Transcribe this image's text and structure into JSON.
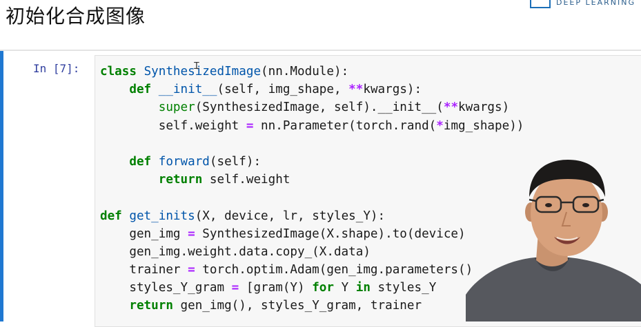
{
  "header": {
    "title": "初始化合成图像",
    "logo_text": "DEEP LEARNING"
  },
  "cell": {
    "prompt": "In [7]:",
    "lines": [
      [
        {
          "t": "class",
          "c": "kw"
        },
        {
          "t": " "
        },
        {
          "t": "SynthesizedImage",
          "c": "def"
        },
        {
          "t": "(nn.Module):"
        }
      ],
      [
        {
          "t": "    "
        },
        {
          "t": "def",
          "c": "kw"
        },
        {
          "t": " "
        },
        {
          "t": "__init__",
          "c": "def"
        },
        {
          "t": "(self, img_shape, "
        },
        {
          "t": "**",
          "c": "op"
        },
        {
          "t": "kwargs):"
        }
      ],
      [
        {
          "t": "        "
        },
        {
          "t": "super",
          "c": "bi"
        },
        {
          "t": "(SynthesizedImage, self).__init__("
        },
        {
          "t": "**",
          "c": "op"
        },
        {
          "t": "kwargs)"
        }
      ],
      [
        {
          "t": "        self.weight "
        },
        {
          "t": "=",
          "c": "op"
        },
        {
          "t": " nn.Parameter(torch.rand("
        },
        {
          "t": "*",
          "c": "op"
        },
        {
          "t": "img_shape))"
        }
      ],
      [
        {
          "t": ""
        }
      ],
      [
        {
          "t": "    "
        },
        {
          "t": "def",
          "c": "kw"
        },
        {
          "t": " "
        },
        {
          "t": "forward",
          "c": "def"
        },
        {
          "t": "(self):"
        }
      ],
      [
        {
          "t": "        "
        },
        {
          "t": "return",
          "c": "kw"
        },
        {
          "t": " self.weight"
        }
      ],
      [
        {
          "t": ""
        }
      ],
      [
        {
          "t": "def",
          "c": "kw"
        },
        {
          "t": " "
        },
        {
          "t": "get_inits",
          "c": "def"
        },
        {
          "t": "(X, device, lr, styles_Y):"
        }
      ],
      [
        {
          "t": "    gen_img "
        },
        {
          "t": "=",
          "c": "op"
        },
        {
          "t": " SynthesizedImage(X.shape).to(device)"
        }
      ],
      [
        {
          "t": "    gen_img.weight.data.copy_(X.data)"
        }
      ],
      [
        {
          "t": "    trainer "
        },
        {
          "t": "=",
          "c": "op"
        },
        {
          "t": " torch.optim.Adam(gen_img.parameters()"
        }
      ],
      [
        {
          "t": "    styles_Y_gram "
        },
        {
          "t": "=",
          "c": "op"
        },
        {
          "t": " [gram(Y) "
        },
        {
          "t": "for",
          "c": "kw"
        },
        {
          "t": " Y "
        },
        {
          "t": "in",
          "c": "kw"
        },
        {
          "t": " styles_Y"
        }
      ],
      [
        {
          "t": "    "
        },
        {
          "t": "return",
          "c": "kw"
        },
        {
          "t": " gen_img(), styles_Y_gram, trainer"
        }
      ]
    ]
  },
  "colors": {
    "accent_bar": "#1f78d1",
    "keyword": "#008000",
    "definition": "#0055aa",
    "operator": "#aa22ff",
    "prompt": "#303f9f"
  }
}
